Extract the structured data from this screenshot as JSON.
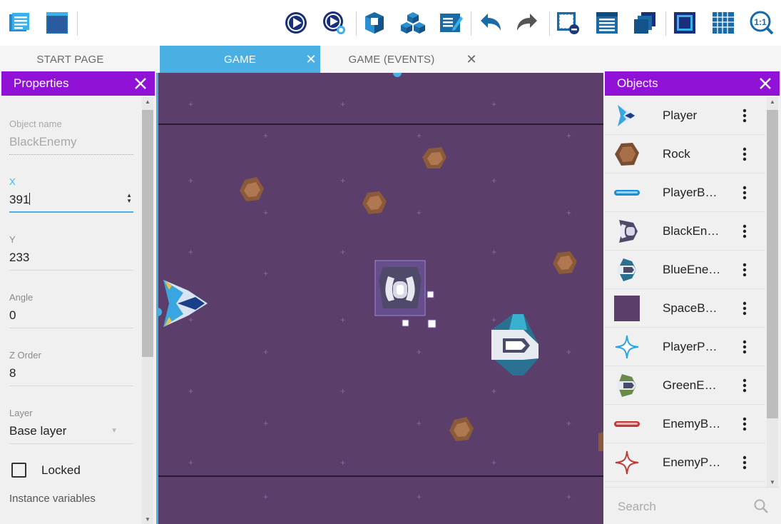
{
  "toolbar": {
    "buttons": [
      {
        "name": "project-manager-icon"
      },
      {
        "name": "window-icon"
      },
      {
        "name": "preview-icon"
      },
      {
        "name": "network-preview-icon"
      },
      {
        "name": "object-editor-icon"
      },
      {
        "name": "object-groups-icon"
      },
      {
        "name": "properties-edit-icon"
      },
      {
        "name": "undo-icon"
      },
      {
        "name": "redo-icon"
      },
      {
        "name": "delete-instance-icon"
      },
      {
        "name": "instances-list-icon"
      },
      {
        "name": "layers-icon"
      },
      {
        "name": "window-mask-icon"
      },
      {
        "name": "grid-icon"
      },
      {
        "name": "zoom-reset-icon"
      }
    ],
    "zoom_text": "1:1"
  },
  "tabs": [
    {
      "label": "START PAGE",
      "active": false,
      "closable": false
    },
    {
      "label": "GAME",
      "active": true,
      "closable": true
    },
    {
      "label": "GAME (EVENTS)",
      "active": false,
      "closable": true
    }
  ],
  "properties": {
    "title": "Properties",
    "object_name_label": "Object name",
    "object_name_value": "BlackEnemy",
    "x_label": "X",
    "x_value": "391",
    "y_label": "Y",
    "y_value": "233",
    "angle_label": "Angle",
    "angle_value": "0",
    "zorder_label": "Z Order",
    "zorder_value": "8",
    "layer_label": "Layer",
    "layer_value": "Base layer",
    "locked_label": "Locked",
    "locked_checked": false,
    "instance_variables_label": "Instance variables"
  },
  "objects": {
    "title": "Objects",
    "items": [
      {
        "label": "Player",
        "icon": "player-ship-icon"
      },
      {
        "label": "Rock",
        "icon": "rock-icon"
      },
      {
        "label": "PlayerB…",
        "icon": "player-bullet-icon"
      },
      {
        "label": "BlackEn…",
        "icon": "black-enemy-icon"
      },
      {
        "label": "BlueEne…",
        "icon": "blue-enemy-icon"
      },
      {
        "label": "SpaceB…",
        "icon": "space-background-icon"
      },
      {
        "label": "PlayerP…",
        "icon": "player-particle-icon"
      },
      {
        "label": "GreenE…",
        "icon": "green-enemy-icon"
      },
      {
        "label": "EnemyB…",
        "icon": "enemy-bullet-icon"
      },
      {
        "label": "EnemyP…",
        "icon": "enemy-particle-icon"
      }
    ],
    "search_placeholder": "Search"
  },
  "colors": {
    "accent_purple": "#9012d6",
    "accent_blue": "#4ab0e4",
    "scene_background": "#5c3e6b"
  }
}
